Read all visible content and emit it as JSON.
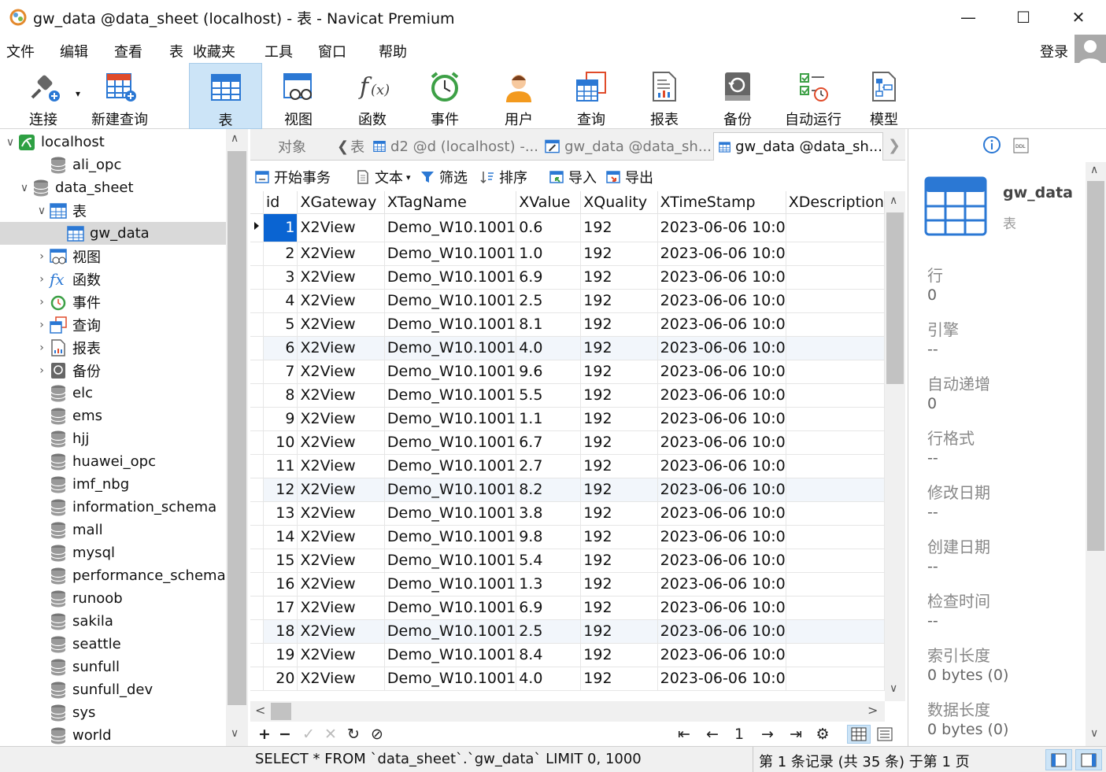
{
  "window": {
    "title": "gw_data @data_sheet (localhost) - 表 - Navicat Premium",
    "min": "—",
    "max": "☐",
    "close": "✕"
  },
  "menu": [
    "文件",
    "编辑",
    "查看",
    "表",
    "收藏夹",
    "工具",
    "窗口",
    "帮助"
  ],
  "login": "登录",
  "toolbar": [
    {
      "label": "连接",
      "icon": "connection-plug-icon"
    },
    {
      "label": "新建查询",
      "icon": "new-query-icon"
    },
    {
      "label": "表",
      "icon": "table-icon"
    },
    {
      "label": "视图",
      "icon": "view-icon"
    },
    {
      "label": "函数",
      "icon": "function-icon"
    },
    {
      "label": "事件",
      "icon": "alarm-clock-icon"
    },
    {
      "label": "用户",
      "icon": "user-icon"
    },
    {
      "label": "查询",
      "icon": "query-icon"
    },
    {
      "label": "报表",
      "icon": "report-icon"
    },
    {
      "label": "备份",
      "icon": "backup-icon"
    },
    {
      "label": "自动运行",
      "icon": "automation-icon"
    },
    {
      "label": "模型",
      "icon": "model-icon"
    }
  ],
  "tree": {
    "root": "localhost",
    "items": [
      {
        "label": "ali_opc"
      },
      {
        "label": "data_sheet"
      },
      {
        "label": "表"
      },
      {
        "label": "gw_data"
      },
      {
        "label": "视图"
      },
      {
        "label": "函数"
      },
      {
        "label": "事件"
      },
      {
        "label": "查询"
      },
      {
        "label": "报表"
      },
      {
        "label": "备份"
      },
      {
        "label": "elc"
      },
      {
        "label": "ems"
      },
      {
        "label": "hjj"
      },
      {
        "label": "huawei_opc"
      },
      {
        "label": "imf_nbg"
      },
      {
        "label": "information_schema"
      },
      {
        "label": "mall"
      },
      {
        "label": "mysql"
      },
      {
        "label": "performance_schema"
      },
      {
        "label": "runoob"
      },
      {
        "label": "sakila"
      },
      {
        "label": "seattle"
      },
      {
        "label": "sunfull"
      },
      {
        "label": "sunfull_dev"
      },
      {
        "label": "sys"
      },
      {
        "label": "world"
      }
    ]
  },
  "tabs": {
    "objects": "对象",
    "partial": "表",
    "tab1": "d2 @d (localhost) -...",
    "tab2": "gw_data @data_sh...",
    "tab3": "gw_data @data_sh..."
  },
  "objbar": {
    "begin": "开始事务",
    "text": "文本",
    "filter": "筛选",
    "sort": "排序",
    "import": "导入",
    "export": "导出"
  },
  "grid": {
    "columns": [
      "id",
      "XGateway",
      "XTagName",
      "XValue",
      "XQuality",
      "XTimeStamp",
      "XDescription"
    ],
    "rows": [
      [
        "1",
        "X2View",
        "Demo_W10.1001",
        "0.6",
        "192",
        "2023-06-06 10:0",
        ""
      ],
      [
        "2",
        "X2View",
        "Demo_W10.1001",
        "1.0",
        "192",
        "2023-06-06 10:0",
        ""
      ],
      [
        "3",
        "X2View",
        "Demo_W10.1001",
        "6.9",
        "192",
        "2023-06-06 10:0",
        ""
      ],
      [
        "4",
        "X2View",
        "Demo_W10.1001",
        "2.5",
        "192",
        "2023-06-06 10:0",
        ""
      ],
      [
        "5",
        "X2View",
        "Demo_W10.1001",
        "8.1",
        "192",
        "2023-06-06 10:0",
        ""
      ],
      [
        "6",
        "X2View",
        "Demo_W10.1001",
        "4.0",
        "192",
        "2023-06-06 10:0",
        ""
      ],
      [
        "7",
        "X2View",
        "Demo_W10.1001",
        "9.6",
        "192",
        "2023-06-06 10:0",
        ""
      ],
      [
        "8",
        "X2View",
        "Demo_W10.1001",
        "5.5",
        "192",
        "2023-06-06 10:0",
        ""
      ],
      [
        "9",
        "X2View",
        "Demo_W10.1001",
        "1.1",
        "192",
        "2023-06-06 10:0",
        ""
      ],
      [
        "10",
        "X2View",
        "Demo_W10.1001",
        "6.7",
        "192",
        "2023-06-06 10:0",
        ""
      ],
      [
        "11",
        "X2View",
        "Demo_W10.1001",
        "2.7",
        "192",
        "2023-06-06 10:0",
        ""
      ],
      [
        "12",
        "X2View",
        "Demo_W10.1001",
        "8.2",
        "192",
        "2023-06-06 10:0",
        ""
      ],
      [
        "13",
        "X2View",
        "Demo_W10.1001",
        "3.8",
        "192",
        "2023-06-06 10:0",
        ""
      ],
      [
        "14",
        "X2View",
        "Demo_W10.1001",
        "9.8",
        "192",
        "2023-06-06 10:0",
        ""
      ],
      [
        "15",
        "X2View",
        "Demo_W10.1001",
        "5.4",
        "192",
        "2023-06-06 10:0",
        ""
      ],
      [
        "16",
        "X2View",
        "Demo_W10.1001",
        "1.3",
        "192",
        "2023-06-06 10:0",
        ""
      ],
      [
        "17",
        "X2View",
        "Demo_W10.1001",
        "6.9",
        "192",
        "2023-06-06 10:0",
        ""
      ],
      [
        "18",
        "X2View",
        "Demo_W10.1001",
        "2.5",
        "192",
        "2023-06-06 10:0",
        ""
      ],
      [
        "19",
        "X2View",
        "Demo_W10.1001",
        "8.4",
        "192",
        "2023-06-06 10:0",
        ""
      ],
      [
        "20",
        "X2View",
        "Demo_W10.1001",
        "4.0",
        "192",
        "2023-06-06 10:0",
        ""
      ]
    ]
  },
  "navbar": {
    "page": "1"
  },
  "info": {
    "name": "gw_data",
    "type": "表",
    "props": [
      {
        "label": "行",
        "value": "0"
      },
      {
        "label": "引擎",
        "value": "--"
      },
      {
        "label": "自动递增",
        "value": "0"
      },
      {
        "label": "行格式",
        "value": "--"
      },
      {
        "label": "修改日期",
        "value": "--"
      },
      {
        "label": "创建日期",
        "value": "--"
      },
      {
        "label": "检查时间",
        "value": "--"
      },
      {
        "label": "索引长度",
        "value": "0 bytes (0)"
      },
      {
        "label": "数据长度",
        "value": "0 bytes (0)"
      }
    ]
  },
  "status": {
    "sql": "SELECT * FROM `data_sheet`.`gw_data` LIMIT 0, 1000",
    "records": "第 1 条记录 (共 35 条) 于第 1 页"
  },
  "colors": {
    "accent": "#0a64d2",
    "active_tool": "#cce4f7",
    "selected_tree": "#d9d9d9"
  }
}
